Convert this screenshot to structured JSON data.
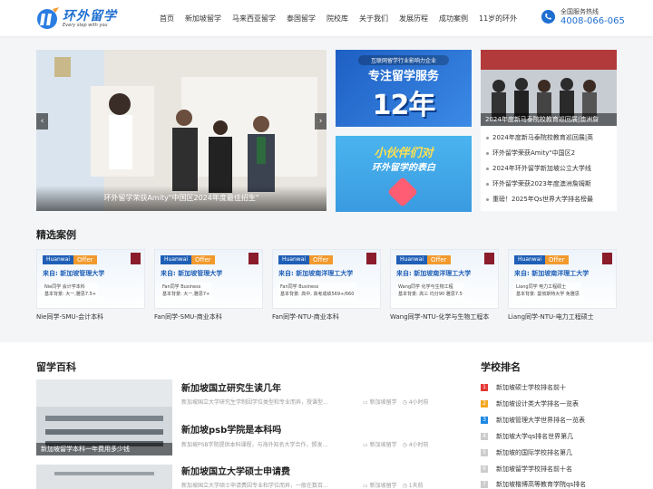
{
  "header": {
    "logo_text": "环外留学",
    "logo_slogan": "Every step with you",
    "nav": [
      "首页",
      "新加坡留学",
      "马来西亚留学",
      "泰国留学",
      "院校库",
      "关于我们",
      "发展历程",
      "成功案例",
      "11岁的环外"
    ],
    "hotline_label": "全国服务热线",
    "hotline_number": "4008-066-065"
  },
  "banner": {
    "caption": "环外留学荣获Amity\"中国区2024年度最佳招生\"",
    "prev": "‹",
    "next": "›"
  },
  "promo1": {
    "subtitle": "互联网留学行业影响力企业",
    "title": "专注留学服务",
    "number": "12年"
  },
  "promo2": {
    "line1": "小伙伴们对",
    "line2": "环外留学的表白"
  },
  "news": {
    "photo_caption": "2024年度新马泰院校教育巡回展|澳洲詹",
    "items": [
      "2024年度新马泰院校教育巡回展|英",
      "环外留学荣获Amity\"中国区2",
      "2024年环外留学新加坡公立大学线",
      "环外留学荣获2023年度澳洲詹姆斯",
      "重磅！2025年Qs世界大学排名榜最"
    ]
  },
  "cases": {
    "title": "精选案例",
    "brand": "Huanwai",
    "offer": "Offer",
    "items": [
      {
        "school": "来自: 新加坡管理大学",
        "detail1": "Nie同学  会计学本科",
        "detail2": "基本背景: 大一,雅思7.5+",
        "label": "Nie同学-SMU-会计本科"
      },
      {
        "school": "来自: 新加坡管理大学",
        "detail1": "Fan同学  Business",
        "detail2": "基本背景: 大一,雅思7+",
        "label": "Fan同学-SMU-商业本科"
      },
      {
        "school": "来自: 新加坡南洋理工大学",
        "detail1": "Fan同学  Business",
        "detail2": "基本背景: 高中, 高考成绩569+/660",
        "label": "Fan同学-NTU-商业本科"
      },
      {
        "school": "来自: 新加坡南洋理工大学",
        "detail1": "Wang同学  化学与生物工程",
        "detail2": "基本背景: 高三 均分90 雅思7.5",
        "label": "Wang同学-NTU-化学与生物工程本"
      },
      {
        "school": "来自: 新加坡南洋理工大学",
        "detail1": "Liang同学  电力工程硕士",
        "detail2": "基本背景: 曼彻斯特大学 免雅思",
        "label": "Liang同学-NTU-电力工程硕士"
      }
    ]
  },
  "wiki": {
    "title": "留学百科",
    "items": [
      {
        "thumb_caption": "新加坡留学本科一年费用多少钱",
        "title": "新加坡国立研究生读几年",
        "summary": "新加坡国立大学研究生学制因学位类型和专业而异，授课型...",
        "category": "新加坡留学",
        "time": "4小时前"
      },
      {
        "title": "新加坡psb学院是本科吗",
        "summary": "新加坡PSB学院提供本科课程，与海外知名大学合作，颁发...",
        "category": "新加坡留学",
        "time": "4小时前"
      },
      {
        "title": "新加坡国立大学硕士申请费",
        "summary": "新加坡国立大学硕士申请费因专业和学位而异，一般在数百...",
        "category": "新加坡留学",
        "time": "1天前"
      }
    ]
  },
  "ranking": {
    "title": "学校排名",
    "colors": [
      "#e53935",
      "#f5a623",
      "#1e88e5",
      "#cccccc"
    ],
    "items": [
      {
        "rank": "1",
        "label": "新加坡硕士学校排名前十"
      },
      {
        "rank": "2",
        "label": "新加坡设计类大学排名一览表"
      },
      {
        "rank": "3",
        "label": "新加坡管理大学世界排名一览表"
      },
      {
        "rank": "4",
        "label": "新加坡大学qs排名世界第几"
      },
      {
        "rank": "5",
        "label": "新加坡的国际学校排名第几"
      },
      {
        "rank": "6",
        "label": "新加坡留学学校排名前十名"
      },
      {
        "rank": "7",
        "label": "新加坡楷博高等教育学院qs排名"
      }
    ]
  }
}
